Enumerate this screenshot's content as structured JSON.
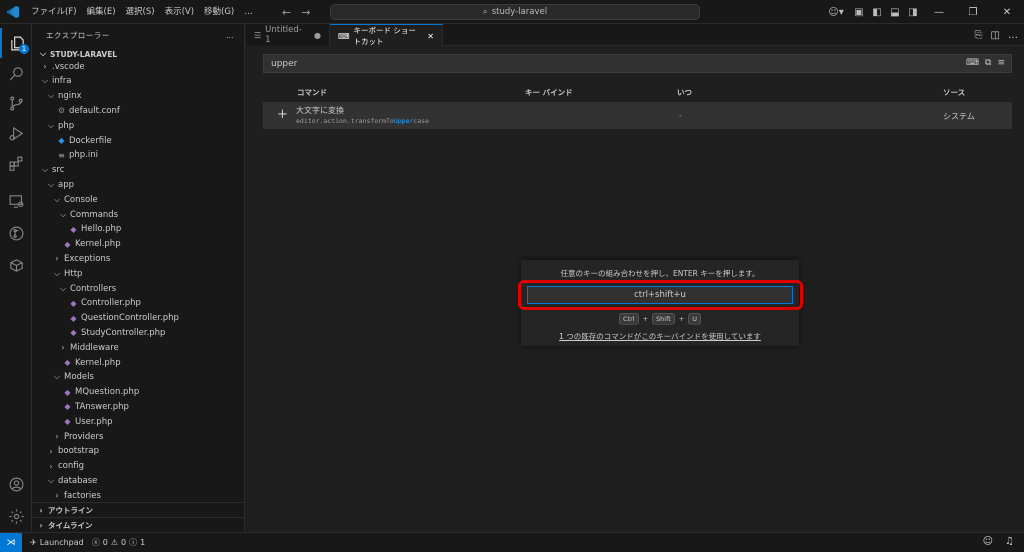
{
  "titlebar": {
    "menus": [
      "ファイル(F)",
      "編集(E)",
      "選択(S)",
      "表示(V)",
      "移動(G)",
      "…"
    ],
    "search_text": "study-laravel"
  },
  "activity": {
    "explorer_badge": "1"
  },
  "sidebar": {
    "header": "エクスプローラー",
    "more": "…",
    "root": "STUDY-LARAVEL",
    "tree": [
      {
        "label": ".vscode",
        "depth": 1,
        "type": "folder-closed"
      },
      {
        "label": "infra",
        "depth": 1,
        "type": "folder-open"
      },
      {
        "label": "nginx",
        "depth": 2,
        "type": "folder-open"
      },
      {
        "label": "default.conf",
        "depth": 3,
        "type": "gear"
      },
      {
        "label": "php",
        "depth": 2,
        "type": "folder-open"
      },
      {
        "label": "Dockerfile",
        "depth": 3,
        "type": "docker"
      },
      {
        "label": "php.ini",
        "depth": 3,
        "type": "ini"
      },
      {
        "label": "src",
        "depth": 1,
        "type": "folder-open"
      },
      {
        "label": "app",
        "depth": 2,
        "type": "folder-open"
      },
      {
        "label": "Console",
        "depth": 3,
        "type": "folder-open"
      },
      {
        "label": "Commands",
        "depth": 4,
        "type": "folder-open"
      },
      {
        "label": "Hello.php",
        "depth": 5,
        "type": "php"
      },
      {
        "label": "Kernel.php",
        "depth": 4,
        "type": "php"
      },
      {
        "label": "Exceptions",
        "depth": 3,
        "type": "folder-closed"
      },
      {
        "label": "Http",
        "depth": 3,
        "type": "folder-open"
      },
      {
        "label": "Controllers",
        "depth": 4,
        "type": "folder-open"
      },
      {
        "label": "Controller.php",
        "depth": 5,
        "type": "php"
      },
      {
        "label": "QuestionController.php",
        "depth": 5,
        "type": "php"
      },
      {
        "label": "StudyController.php",
        "depth": 5,
        "type": "php"
      },
      {
        "label": "Middleware",
        "depth": 4,
        "type": "folder-closed"
      },
      {
        "label": "Kernel.php",
        "depth": 4,
        "type": "php"
      },
      {
        "label": "Models",
        "depth": 3,
        "type": "folder-open"
      },
      {
        "label": "MQuestion.php",
        "depth": 4,
        "type": "php"
      },
      {
        "label": "TAnswer.php",
        "depth": 4,
        "type": "php"
      },
      {
        "label": "User.php",
        "depth": 4,
        "type": "php"
      },
      {
        "label": "Providers",
        "depth": 3,
        "type": "folder-closed"
      },
      {
        "label": "bootstrap",
        "depth": 2,
        "type": "folder-closed"
      },
      {
        "label": "config",
        "depth": 2,
        "type": "folder-closed"
      },
      {
        "label": "database",
        "depth": 2,
        "type": "folder-open"
      },
      {
        "label": "factories",
        "depth": 3,
        "type": "folder-closed"
      }
    ],
    "outline": "アウトライン",
    "timeline": "タイムライン"
  },
  "tabs": [
    {
      "label": "Untitled-1",
      "state": "●"
    },
    {
      "label": "キーボード ショートカット",
      "state": "✕"
    }
  ],
  "keybindings": {
    "search_value": "upper",
    "columns": {
      "command": "コマンド",
      "keybinding": "キー バインド",
      "when": "いつ",
      "source": "ソース"
    },
    "row": {
      "command": "大文字に変換",
      "id_prefix": "editor.action.transformTo",
      "id_match": "Upper",
      "id_suffix": "case",
      "when": "-",
      "source": "システム"
    }
  },
  "widget": {
    "message": "任意のキーの組み合わせを押し、ENTER キーを押します。",
    "input_value": "ctrl+shift+u",
    "keys": [
      "Ctrl",
      "+",
      "Shift",
      "+",
      "U"
    ],
    "conflict_link": "1 つの既存のコマンドがこのキーバインドを使用しています"
  },
  "statusbar": {
    "launchpad": "Launchpad",
    "errors": "0",
    "warnings": "0",
    "info": "1"
  }
}
